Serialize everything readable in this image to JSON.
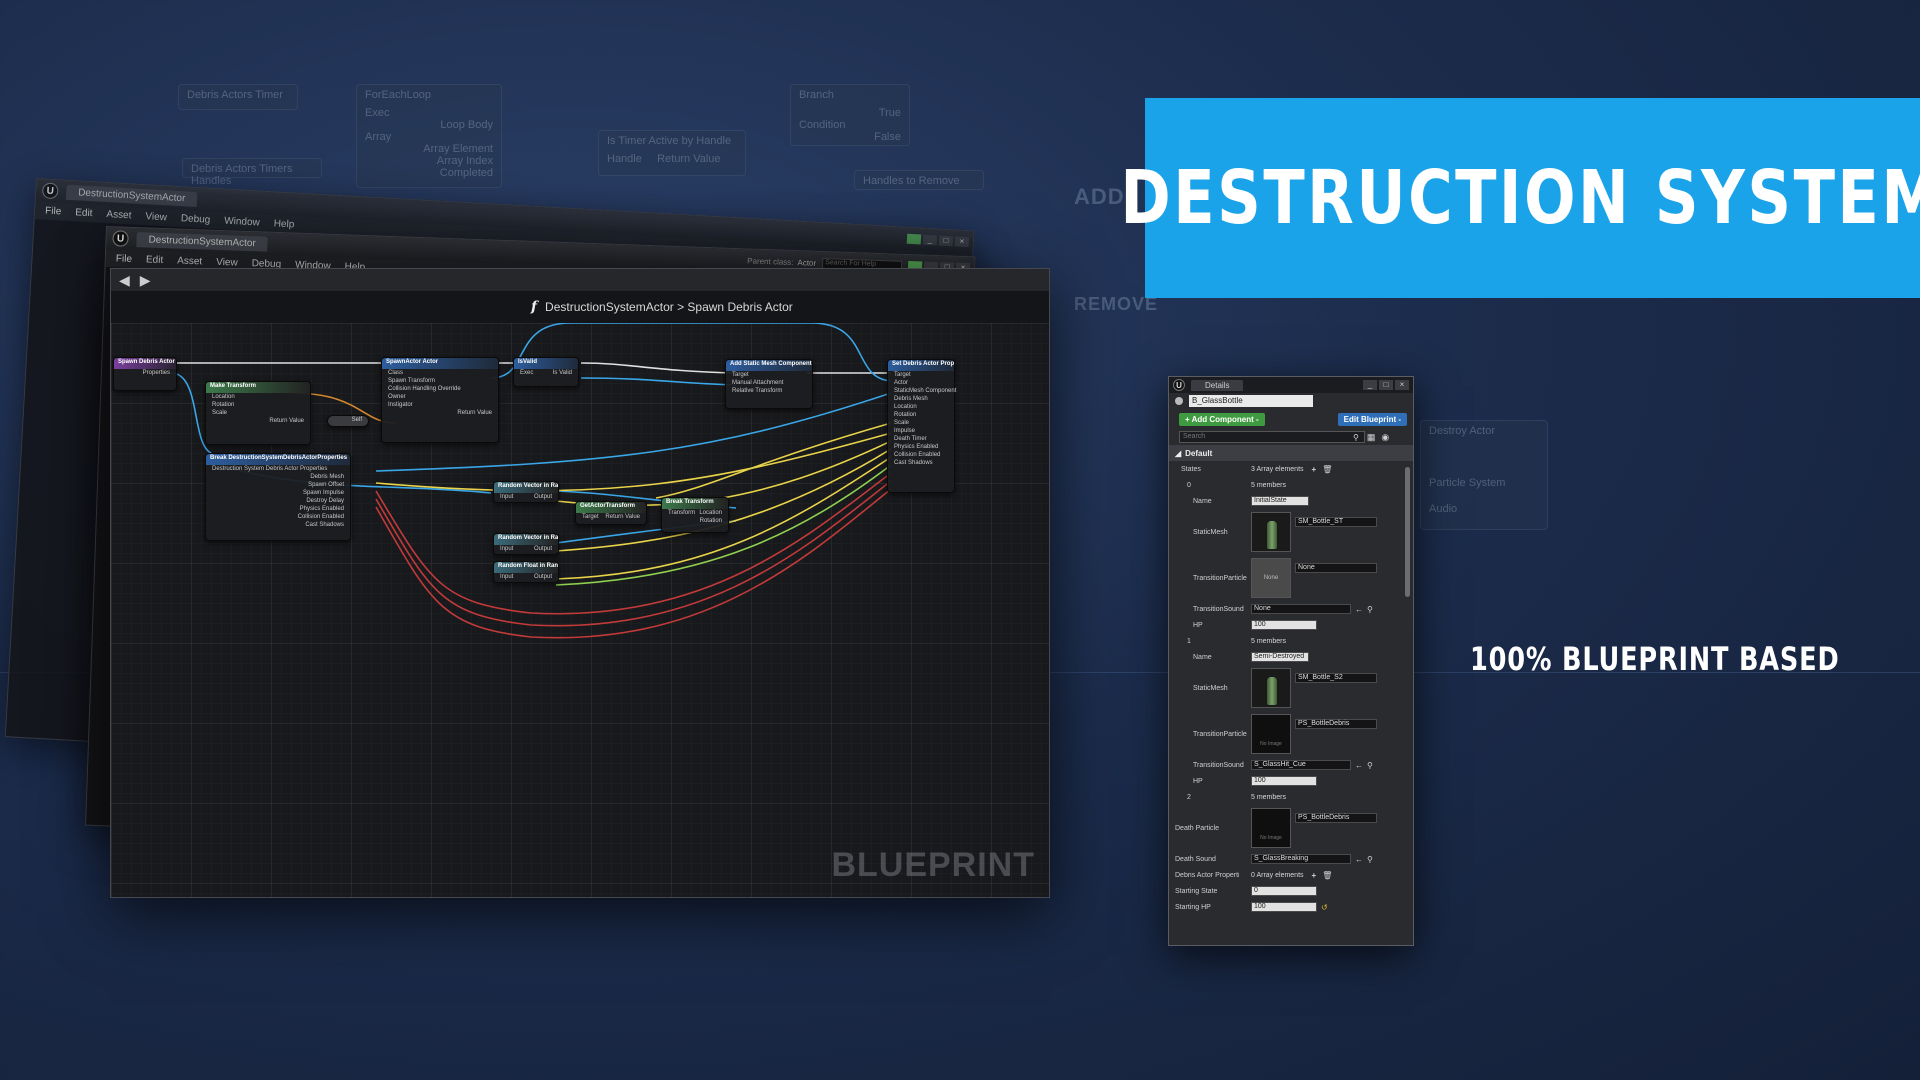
{
  "banner": {
    "title": "DESTRUCTION SYSTEM",
    "tagline": "100% BLUEPRINT BASED"
  },
  "background": {
    "nodes": [
      {
        "title": "Debris Actors Timer"
      },
      {
        "title": "ForEachLoop",
        "pins": [
          "Exec",
          "Loop Body",
          "Array",
          "Array Element",
          "Array Index",
          "Completed"
        ]
      },
      {
        "title": "Branch",
        "pins": [
          "True",
          "Condition",
          "False"
        ]
      },
      {
        "title": "Is Timer Active by Handle",
        "pins": [
          "Handle",
          "Return Value"
        ]
      },
      {
        "title": "Debris Actors Timers Handles"
      },
      {
        "title": "Handles to Remove"
      }
    ],
    "words": [
      "ADD",
      "REMOVE"
    ],
    "right_labels": [
      "Destroy Actor",
      "Particle System",
      "Audio"
    ]
  },
  "back_windows": [
    {
      "tab": "DestructionSystemActor",
      "menu": [
        "File",
        "Edit",
        "Asset",
        "View",
        "Debug",
        "Window",
        "Help"
      ]
    },
    {
      "tab": "DestructionSystemActor",
      "menu": [
        "File",
        "Edit",
        "Asset",
        "View",
        "Debug",
        "Window",
        "Help"
      ],
      "parent_label": "Parent class:",
      "parent_value": "Actor",
      "search": "Search For Help"
    }
  ],
  "editor": {
    "breadcrumb": "DestructionSystemActor > Spawn Debris Actor",
    "function_glyph": "f",
    "watermark": "BLUEPRINT",
    "nodes": [
      {
        "title": "Spawn Debris Actor",
        "pins": [
          "Properties"
        ]
      },
      {
        "title": "Make Transform",
        "pins": [
          "Location",
          "Rotation",
          "Scale",
          "Return Value"
        ]
      },
      {
        "title": "SpawnActor Actor",
        "pins": [
          "Class",
          "Spawn Transform",
          "Collision Handling Override",
          "Owner",
          "Instigator",
          "Return Value"
        ]
      },
      {
        "title": "IsValid",
        "pins": [
          "Exec",
          "Input Object",
          "Is Valid",
          "Is Not Valid"
        ]
      },
      {
        "title": "Add Static Mesh Component",
        "pins": [
          "Target",
          "Manual Attachment",
          "Relative Transform",
          "Return Value"
        ]
      },
      {
        "title": "Set Debris Actor Properties",
        "pins": [
          "Target",
          "Actor",
          "StaticMesh Component",
          "Debris Mesh",
          "Location",
          "Rotation",
          "Scale",
          "Impulse",
          "Death Timer",
          "Physics Enabled",
          "Collision Enabled",
          "Cast Shadows"
        ]
      },
      {
        "title": "Break DestructionSystemDebrisActorProperties",
        "pins": [
          "Destruction System Debris Actor Properties",
          "Debris Mesh",
          "Spawn Offset",
          "Spawn Impulse",
          "Destroy Delay",
          "Physics Enabled",
          "Collision Enabled",
          "Cast Shadows"
        ]
      },
      {
        "title": "Random Vector in Range",
        "pins": [
          "Input",
          "Output"
        ]
      },
      {
        "title": "Random Vector in Range",
        "pins": [
          "Input",
          "Output"
        ]
      },
      {
        "title": "Random Float in Range",
        "pins": [
          "Input",
          "Output"
        ]
      },
      {
        "title": "GetActorTransform",
        "pins": [
          "Target",
          "Return Value"
        ]
      },
      {
        "title": "Break Transform",
        "pins": [
          "Transform",
          "Location",
          "Rotation",
          "Scale"
        ]
      },
      {
        "title": "Self",
        "pins": []
      }
    ]
  },
  "details": {
    "tab": "Details",
    "blueprint_name": "B_GlassBottle",
    "add_component": "+ Add Component -",
    "edit_blueprint": "Edit Blueprint -",
    "search_placeholder": "Search",
    "category": "Default",
    "states_label": "States",
    "states_value": "3 Array elements",
    "state0": {
      "index": "0",
      "members": "5 members",
      "name_label": "Name",
      "name": "InitialState",
      "mesh_label": "StaticMesh",
      "mesh": "SM_Bottle_ST",
      "particle_label": "TransitionParticle",
      "particle": "None",
      "particle_thumb": "None",
      "sound_label": "TransitionSound",
      "sound": "None",
      "hp_label": "HP",
      "hp": "100"
    },
    "state1": {
      "index": "1",
      "members": "5 members",
      "name_label": "Name",
      "name": "Semi-Destroyed",
      "mesh_label": "StaticMesh",
      "mesh": "SM_Bottle_S2",
      "particle_label": "TransitionParticle",
      "particle": "PS_BottleDebris",
      "sound_label": "TransitionSound",
      "sound": "S_GlassHit_Cue",
      "hp_label": "HP",
      "hp": "100"
    },
    "state2": {
      "index": "2",
      "members": "5 members"
    },
    "death_particle_label": "Death Particle",
    "death_particle": "PS_BottleDebris",
    "death_sound_label": "Death Sound",
    "death_sound": "S_GlassBreaking",
    "debris_label": "Debris Actor Properties",
    "debris_value": "0 Array elements",
    "starting_state_label": "Starting State",
    "starting_state": "0",
    "starting_hp_label": "Starting HP",
    "starting_hp": "100",
    "no_image": "No Image"
  },
  "colors": {
    "banner": "#1aa3e8",
    "background": "#1c2c4c",
    "wire_blue": "#3aa6e8",
    "wire_yellow": "#e8d34a",
    "wire_red": "#c23a3a",
    "wire_white": "#e0e0e0"
  }
}
